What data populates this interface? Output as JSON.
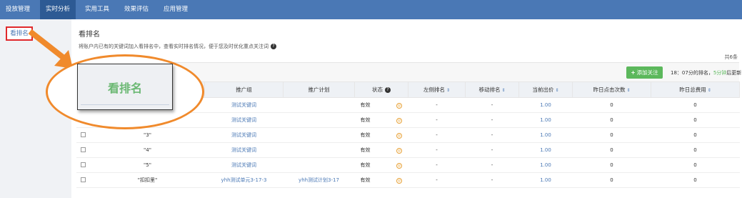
{
  "topnav": {
    "items": [
      {
        "label": "投放管理",
        "active": false
      },
      {
        "label": "实时分析",
        "active": true
      },
      {
        "label": "实用工具",
        "active": false
      },
      {
        "label": "效果评估",
        "active": false
      },
      {
        "label": "应用管理",
        "active": false
      }
    ]
  },
  "sidebar": {
    "items": [
      {
        "label": "看排名"
      }
    ]
  },
  "main": {
    "title": "看排名",
    "description": "将账户内已有的关键词加入看排名中，查看实时排名情况，便于您及时优化重点关注词",
    "total": "共6条",
    "follow_button": "添加关注",
    "rank_note_prefix": "18：07分的排名，",
    "rank_note_highlight": "5分钟",
    "rank_note_suffix": "后更新"
  },
  "table": {
    "headers": [
      "推广组",
      "推广计划",
      "状态",
      "左侧排名",
      "移动排名",
      "当前出价",
      "昨日点击次数",
      "昨日总费用"
    ],
    "rows": [
      {
        "keyword": "",
        "group": "测试关键词",
        "plan": "",
        "status": "有效",
        "left_rank": "-",
        "mobile_rank": "-",
        "bid": "1.00",
        "clicks": "0",
        "cost": "0",
        "show_cb": false
      },
      {
        "keyword": "",
        "group": "测试关键词",
        "plan": "",
        "status": "有效",
        "left_rank": "-",
        "mobile_rank": "-",
        "bid": "1.00",
        "clicks": "0",
        "cost": "0",
        "show_cb": false
      },
      {
        "keyword": "\"3\"",
        "group": "测试关键词",
        "plan": "",
        "status": "有效",
        "left_rank": "-",
        "mobile_rank": "-",
        "bid": "1.00",
        "clicks": "0",
        "cost": "0",
        "show_cb": true
      },
      {
        "keyword": "\"4\"",
        "group": "测试关键词",
        "plan": "",
        "status": "有效",
        "left_rank": "-",
        "mobile_rank": "-",
        "bid": "1.00",
        "clicks": "0",
        "cost": "0",
        "show_cb": true
      },
      {
        "keyword": "\"5\"",
        "group": "测试关键词",
        "plan": "",
        "status": "有效",
        "left_rank": "-",
        "mobile_rank": "-",
        "bid": "1.00",
        "clicks": "0",
        "cost": "0",
        "show_cb": true
      },
      {
        "keyword": "\"扣扣里\"",
        "group": "yhh测试单元3-17-3",
        "plan": "yhh测试计划3-17",
        "status": "有效",
        "left_rank": "-",
        "mobile_rank": "-",
        "bid": "1.00",
        "clicks": "0",
        "cost": "0",
        "show_cb": true
      }
    ]
  },
  "overlay": {
    "label": "看排名"
  },
  "colors": {
    "nav": "#4a78b5",
    "accent_green": "#5cb85c",
    "highlight_red": "#e0292c",
    "arrow_orange": "#f08a2c"
  }
}
